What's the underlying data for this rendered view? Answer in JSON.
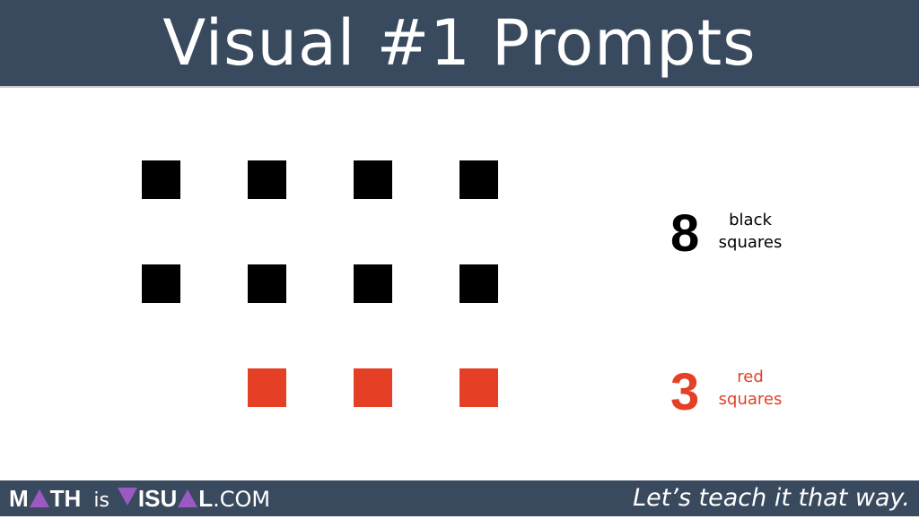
{
  "header": {
    "title": "Visual #1 Prompts"
  },
  "colors": {
    "header_bg": "#3a4a5e",
    "black_square": "#000000",
    "red_square": "#e53f26",
    "logo_accent": "#9b59c4"
  },
  "squares": {
    "black_count": 8,
    "red_count": 3,
    "rows": [
      [
        "black",
        "black",
        "black",
        "black"
      ],
      [
        "black",
        "black",
        "black",
        "black"
      ],
      [
        "empty",
        "red",
        "red",
        "red"
      ]
    ]
  },
  "prompts": [
    {
      "number": "8",
      "line1": "black",
      "line2": "squares",
      "color": "#000000"
    },
    {
      "number": "3",
      "line1": "red",
      "line2": "squares",
      "color": "#e53f26"
    }
  ],
  "footer": {
    "logo": {
      "part1": "M",
      "part2": "TH",
      "is": "is",
      "part3": "ISU",
      "part4": "L",
      "com": ".COM",
      "full_text": "MATH is VISUAL.COM"
    },
    "tagline": "Let’s teach it that way."
  }
}
